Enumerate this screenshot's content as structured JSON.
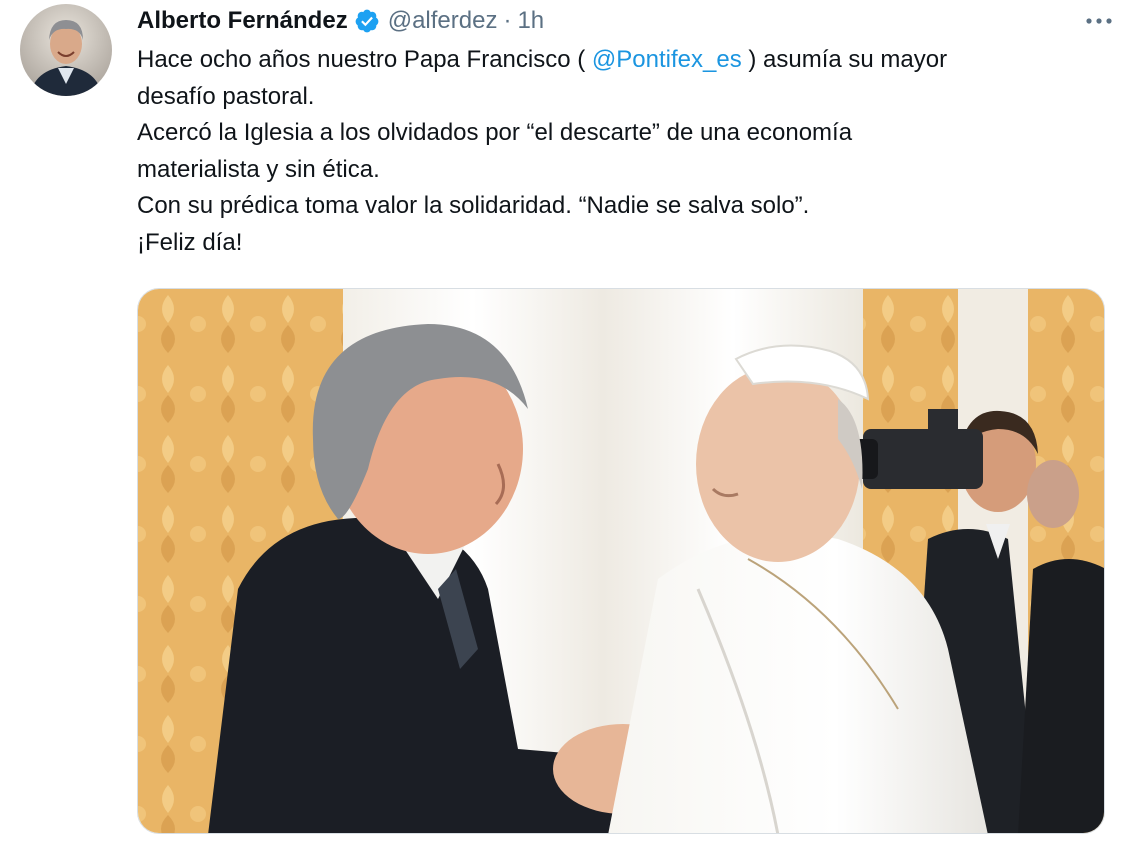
{
  "tweet": {
    "author": {
      "name": "Alberto Fernández",
      "handle": "@alferdez",
      "separator": "·",
      "time": "1h",
      "avatar_icon": "profile-photo",
      "verified_icon": "verified-badge-icon"
    },
    "more_icon": "more-options-icon",
    "text": {
      "line1_before": "Hace ocho años nuestro Papa Francisco ( ",
      "line1_mention": "@Pontifex_es",
      "line1_after": " ) asumía su mayor",
      "line2": "desafío pastoral.",
      "line3": "Acercó la Iglesia a los olvidados por “el descarte” de una economía",
      "line4": "materialista y sin ética.",
      "line5": "Con su prédica toma valor la solidaridad. “Nadie se salva solo”.",
      "line6": "¡Feliz día!"
    },
    "media": {
      "description_icon": "photo-image"
    }
  },
  "colors": {
    "text": "#0f1419",
    "secondary": "#5b7083",
    "link": "#1b95e0",
    "verified": "#1da1f2"
  }
}
